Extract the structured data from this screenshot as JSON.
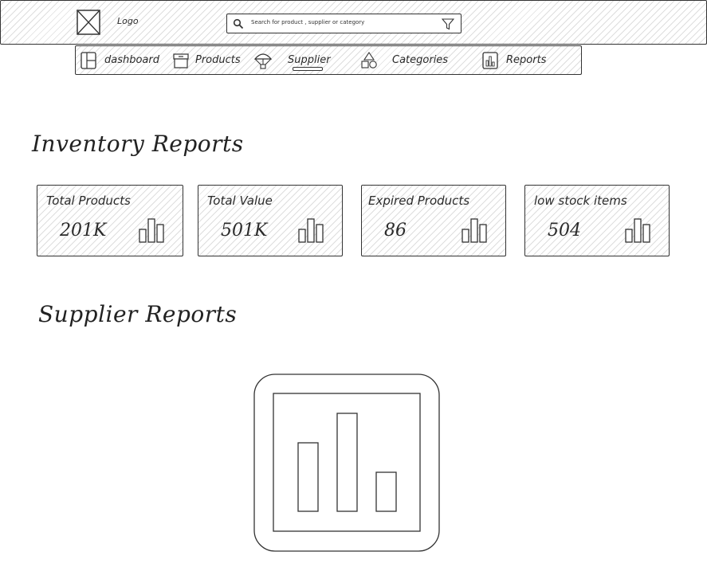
{
  "header": {
    "logo_label": "Logo",
    "search": {
      "placeholder": "Search for product , supplier or category"
    }
  },
  "nav": {
    "items": [
      {
        "label": "dashboard",
        "icon": "dashboard-icon"
      },
      {
        "label": "Products",
        "icon": "archive-box-icon"
      },
      {
        "label": "Supplier",
        "icon": "parachute-icon",
        "active": true
      },
      {
        "label": "Categories",
        "icon": "shapes-icon"
      },
      {
        "label": "Reports",
        "icon": "report-chart-icon"
      }
    ]
  },
  "inventory": {
    "title": "Inventory Reports",
    "cards": [
      {
        "label": "Total Products",
        "value": "201K"
      },
      {
        "label": "Total Value",
        "value": "501K"
      },
      {
        "label": "Expired Products",
        "value": "86"
      },
      {
        "label": "low stock items",
        "value": "504"
      }
    ]
  },
  "supplier": {
    "title": "Supplier Reports",
    "chart_icon": "bar-chart-icon"
  }
}
